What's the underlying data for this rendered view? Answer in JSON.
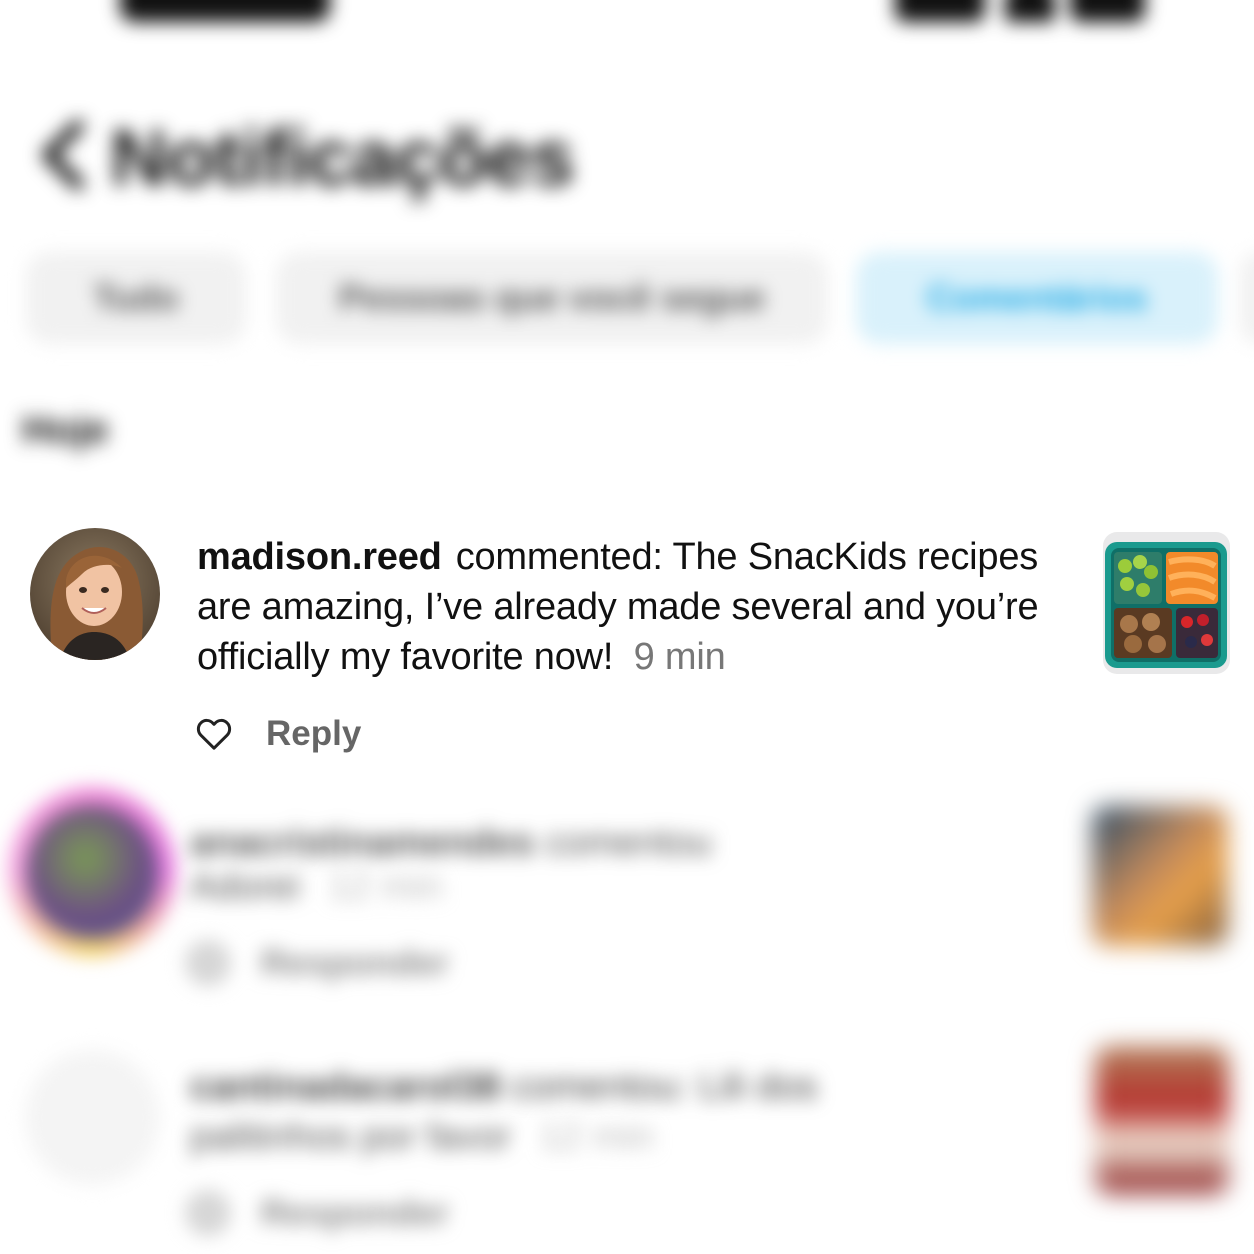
{
  "header": {
    "title": "Notificações"
  },
  "tabs": [
    {
      "label": "Tudo",
      "active": false
    },
    {
      "label": "Pessoas que você segue",
      "active": false
    },
    {
      "label": "Comentários",
      "active": true
    }
  ],
  "section": {
    "label": "Hoje"
  },
  "notifications": [
    {
      "username": "madison.reed",
      "action_text": "commented: The SnacKids recipes are amazing, I’ve already made several and you’re officially my favorite now!",
      "time": "9 min",
      "reply_label": "Reply"
    },
    {
      "username": "anacristinamendes",
      "action_text": "comentou",
      "second_line": "Adorei",
      "time": "12 min",
      "reply_label": "Responder"
    },
    {
      "username": "cantinadacarol38",
      "action_text": "comentou: Lili dos",
      "second_line": "palitinhos por favor",
      "time": "12 min",
      "reply_label": "Responder"
    }
  ],
  "colors": {
    "accent": "#1aa7e4",
    "active_tab_bg": "#d9f1fb",
    "tab_bg": "#f1f1f1",
    "muted_text": "#777777"
  },
  "icons": [
    "back-chevron-icon",
    "heart-icon",
    "signal-icon",
    "wifi-icon",
    "battery-icon"
  ]
}
